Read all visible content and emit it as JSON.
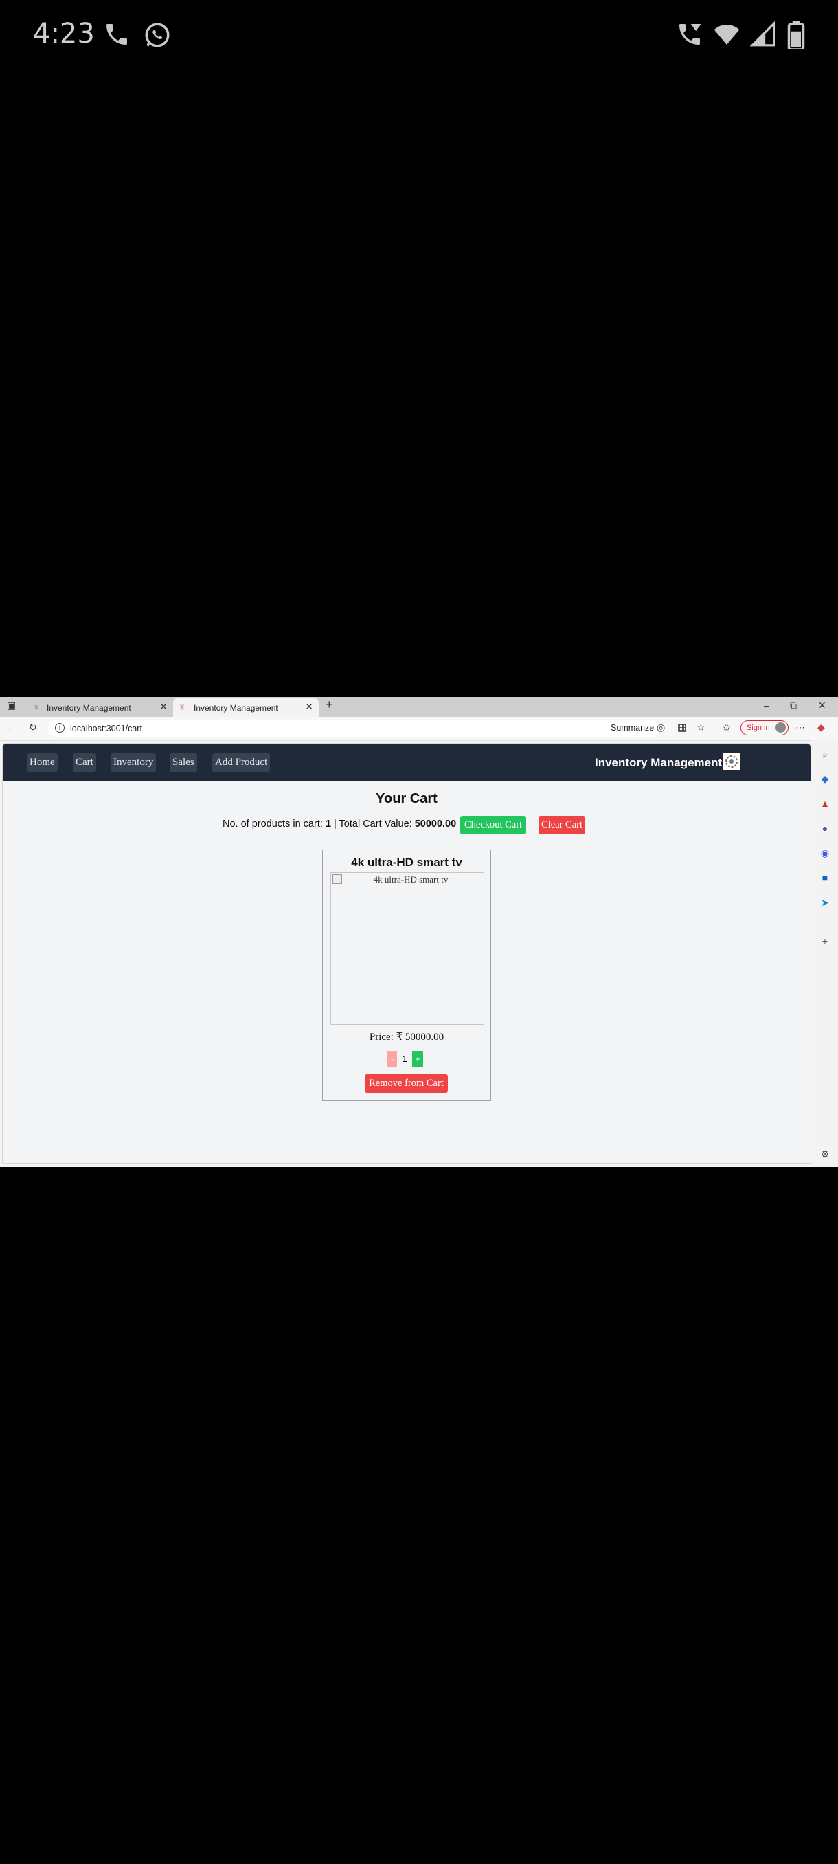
{
  "status_bar": {
    "time": "4:23"
  },
  "browser": {
    "tabs": [
      {
        "title": "Inventory Management",
        "active": false
      },
      {
        "title": "Inventory Management",
        "active": true
      }
    ],
    "address": "localhost:3001/cart",
    "summarize_label": "Summarize",
    "signin_label": "Sign in"
  },
  "app": {
    "nav": [
      "Home",
      "Cart",
      "Inventory",
      "Sales",
      "Add Product"
    ],
    "brand": "Inventory Management",
    "title": "Your Cart",
    "summary": {
      "count_label": "No. of products in cart: ",
      "count": "1",
      "separator": " | Total Cart Value: ",
      "total": "50000.00"
    },
    "checkout_label": "Checkout Cart",
    "clear_label": "Clear Cart",
    "item": {
      "name": "4k ultra-HD smart tv",
      "image_alt": "4k ultra-HD smart tv",
      "price": "Price: ₹ 50000.00",
      "quantity": "1",
      "minus": "-",
      "plus": "+",
      "remove_label": "Remove from Cart"
    }
  },
  "colors": {
    "nav_bg": "#1f2937",
    "green": "#22c55e",
    "red": "#ef4444"
  }
}
